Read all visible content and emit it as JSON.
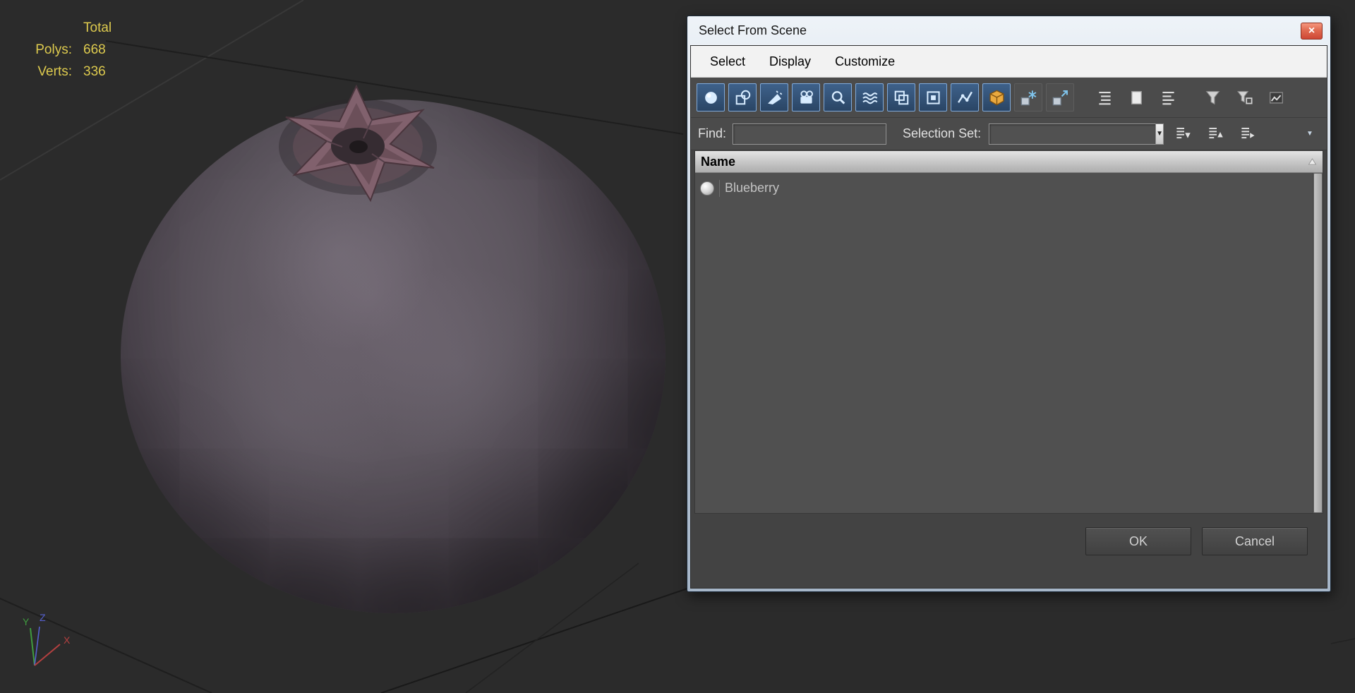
{
  "viewport": {
    "stats": {
      "header": "Total",
      "rows": [
        {
          "label": "Polys:",
          "value": "668"
        },
        {
          "label": "Verts:",
          "value": "336"
        }
      ]
    },
    "axis_labels": {
      "x": "X",
      "y": "Y",
      "z": "Z"
    },
    "object_name": "Blueberry model"
  },
  "dialog": {
    "title": "Select From Scene",
    "menu": {
      "items": [
        "Select",
        "Display",
        "Customize"
      ]
    },
    "toolbar": {
      "icons": [
        "display-geometry",
        "display-shapes",
        "display-lights",
        "display-cameras",
        "display-helpers",
        "display-space-warps",
        "display-groups",
        "display-xrefs",
        "display-bones",
        "display-containers",
        "display-frozen-objects",
        "display-hidden-objects",
        "display-children",
        "display-influences",
        "display-dependents",
        "filter",
        "advanced-filter",
        "custom-filter"
      ]
    },
    "find": {
      "label": "Find:",
      "value": ""
    },
    "selection_set": {
      "label": "Selection Set:",
      "value": ""
    },
    "list": {
      "columns": [
        {
          "label": "Name"
        }
      ],
      "rows": [
        {
          "icon": "geometry-sphere-icon",
          "name": "Blueberry"
        }
      ]
    },
    "buttons": {
      "ok": "OK",
      "cancel": "Cancel"
    },
    "close_glyph": "×"
  },
  "colors": {
    "viewport_background": "#2b2b2b",
    "stats_text": "#ddca4e",
    "toolbar_active_button": "#2f4e73",
    "dialog_frame": "#b7c5d5",
    "close_button": "#d9503c",
    "berry_base": "#554e57",
    "axis_x": "#b44040",
    "axis_y": "#3f9b3f",
    "axis_z": "#5560d0"
  }
}
